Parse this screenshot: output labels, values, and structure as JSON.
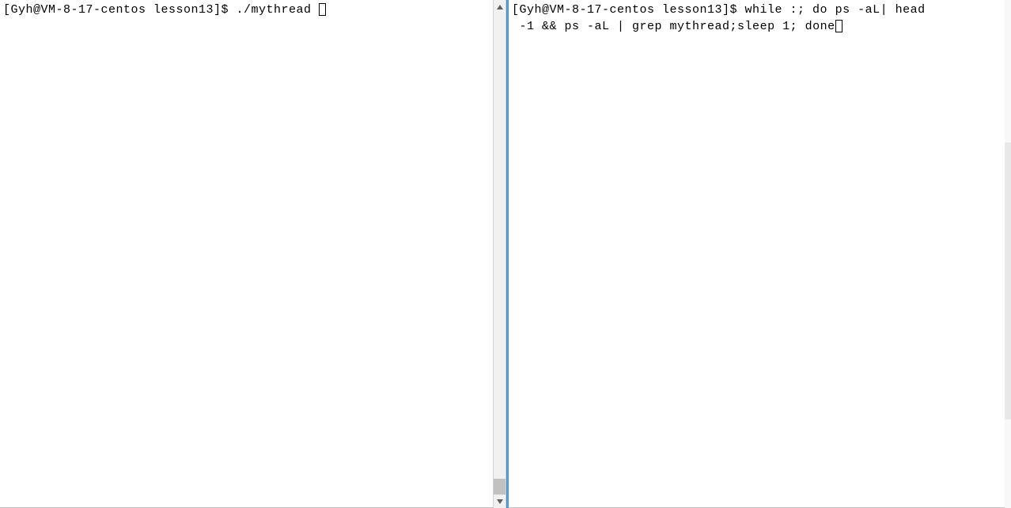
{
  "left_pane": {
    "prompt": "[Gyh@VM-8-17-centos lesson13]$ ",
    "command": "./mythread "
  },
  "right_pane": {
    "prompt": "[Gyh@VM-8-17-centos lesson13]$ ",
    "command_line1": "while :; do ps -aL| head",
    "command_line2": " -1 && ps -aL | grep mythread;sleep 1; done"
  }
}
